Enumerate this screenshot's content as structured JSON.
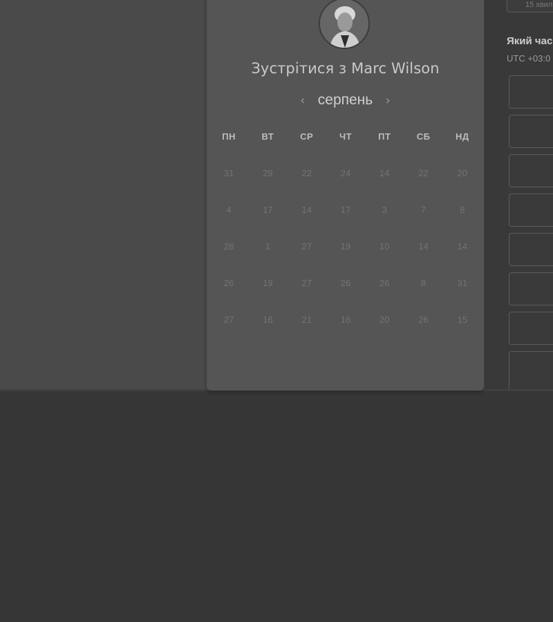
{
  "card": {
    "title": "Зустрітися з Marc Wilson",
    "avatar": "avatar-photo"
  },
  "calendar": {
    "month": "серпень",
    "prev_icon": "chevron-left-icon",
    "next_icon": "chevron-right-icon",
    "prev_glyph": "‹",
    "next_glyph": "›",
    "weekdays": [
      "ПН",
      "ВТ",
      "СР",
      "ЧТ",
      "ПТ",
      "СБ",
      "НД"
    ],
    "weeks": [
      [
        "31",
        "29",
        "22",
        "24",
        "14",
        "22",
        "20"
      ],
      [
        "4",
        "17",
        "14",
        "17",
        "3",
        "7",
        "8"
      ],
      [
        "28",
        "1",
        "27",
        "19",
        "10",
        "14",
        "14"
      ],
      [
        "26",
        "19",
        "27",
        "26",
        "26",
        "8",
        "31"
      ],
      [
        "27",
        "16",
        "21",
        "16",
        "20",
        "26",
        "15"
      ]
    ]
  },
  "right_panel": {
    "duration": "15 хвил",
    "question": "Який час",
    "timezone": "UTC +03:0"
  },
  "colors": {
    "background": "#363636",
    "card": "#555555",
    "top_area": "#4a4a4a",
    "right_panel": "#393939"
  }
}
